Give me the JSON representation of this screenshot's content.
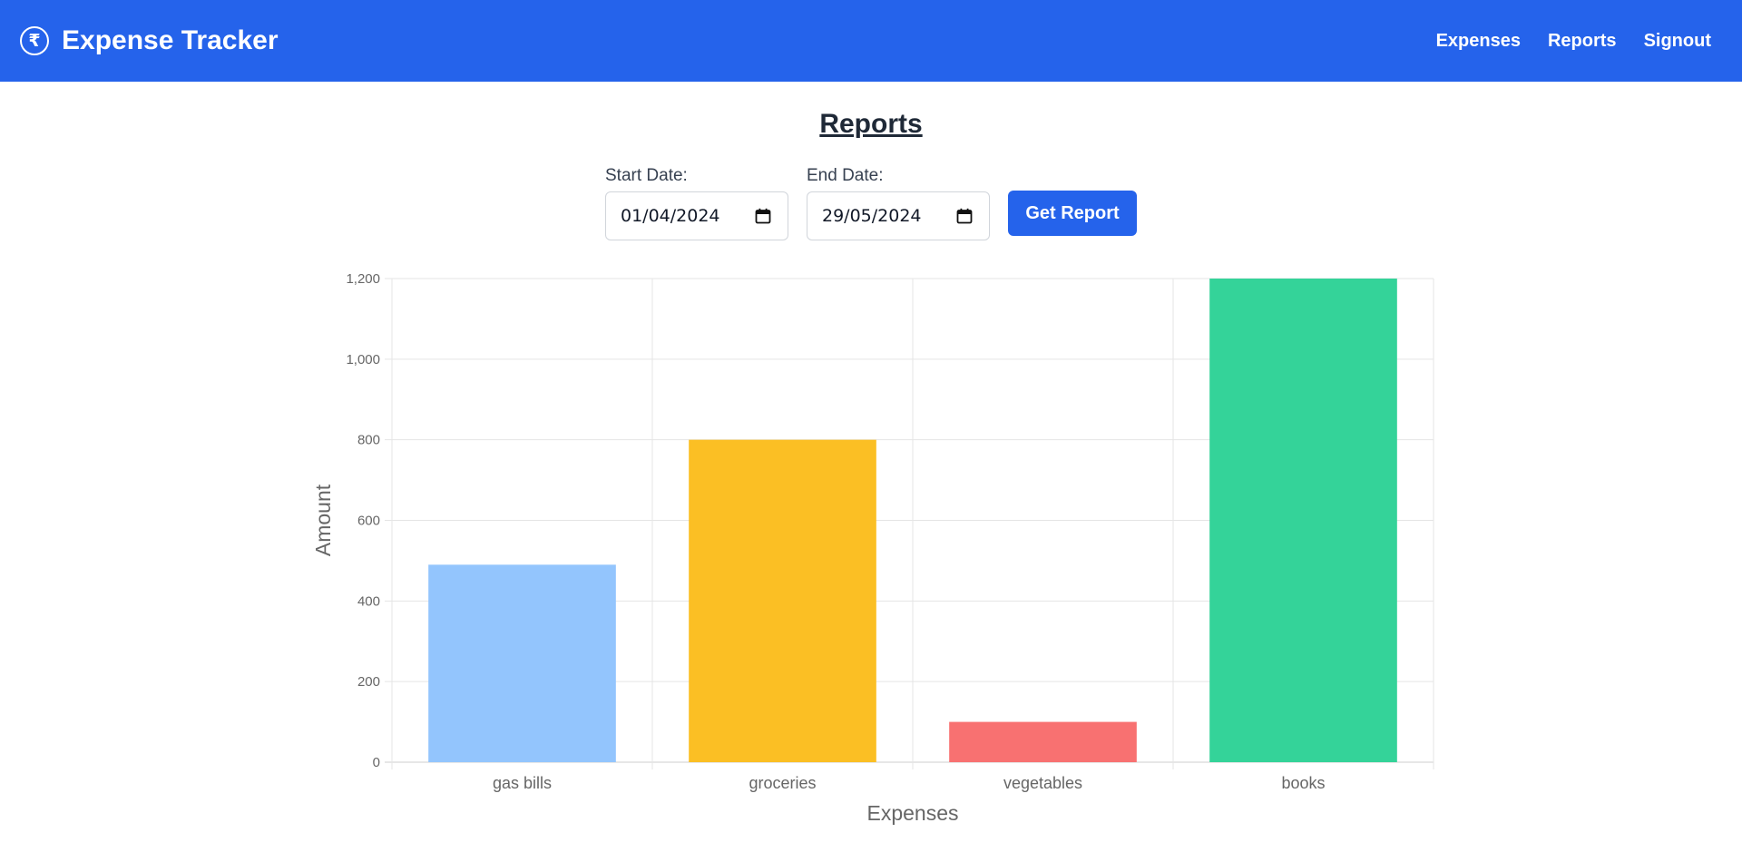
{
  "header": {
    "title": "Expense Tracker",
    "brand_icon": "₹",
    "nav": [
      "Expenses",
      "Reports",
      "Signout"
    ],
    "color": "#2563eb"
  },
  "page": {
    "title": "Reports"
  },
  "form": {
    "start_label": "Start Date:",
    "start_value": "01/04/2024",
    "end_label": "End Date:",
    "end_value": "29/05/2024",
    "button_label": "Get Report"
  },
  "chart_data": {
    "type": "bar",
    "categories": [
      "gas bills",
      "groceries",
      "vegetables",
      "books"
    ],
    "values": [
      490,
      800,
      100,
      1200
    ],
    "colors": [
      "#93c5fd",
      "#fbbf24",
      "#f87171",
      "#34d399"
    ],
    "xlabel": "Expenses",
    "ylabel": "Amount",
    "ylim": [
      0,
      1200
    ],
    "yticks": [
      "0",
      "200",
      "400",
      "600",
      "800",
      "1,000",
      "1,200"
    ],
    "grid": true,
    "legend": "none"
  }
}
